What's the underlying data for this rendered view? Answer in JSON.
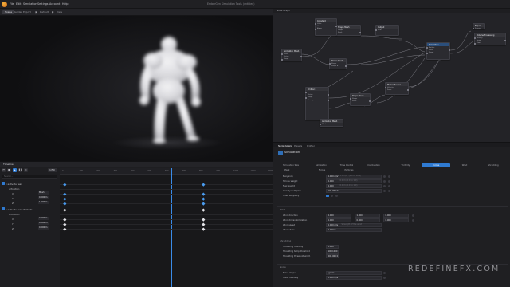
{
  "menubar": {
    "items": [
      "File",
      "Edit",
      "Simulation",
      "Settings",
      "Account",
      "Help"
    ],
    "title": "EmberGen Simulation Tools (untitled)"
  },
  "toolbar": {
    "tabs": [
      "Scene",
      "Render",
      "Export"
    ],
    "default_label": "Default",
    "view_label": "View"
  },
  "colors": {
    "accent": "#2f7ad1",
    "logo": "#e8922a"
  },
  "icons": {
    "play": "play-icon",
    "pause": "pause-icon",
    "stop": "stop-icon",
    "skip": "skip-icon",
    "loop": "loop-icon"
  },
  "timeline": {
    "title": "Timeline",
    "frame": "1/50",
    "search_placeholder": "Search...",
    "ruler": [
      "0",
      "100",
      "200",
      "300",
      "400",
      "500",
      "600",
      "700",
      "800",
      "900",
      "1000",
      "1100",
      "1200"
    ],
    "tracks": [
      {
        "label": "ⅴ activate tear",
        "value": "",
        "indent": 0,
        "checked": true
      },
      {
        "label": "ⅴ Position",
        "value": "",
        "indent": 1,
        "checked": false
      },
      {
        "label": "X",
        "value": "Mesh",
        "indent": 2,
        "checked": false
      },
      {
        "label": "Y",
        "value": "0.000 m",
        "indent": 2,
        "checked": false
      },
      {
        "label": "Z",
        "value": "1.000 m",
        "indent": 2,
        "checked": false
      },
      {
        "label": "ⅴ activate tear attribute",
        "value": "",
        "indent": 0,
        "checked": true
      },
      {
        "label": "ⅴ Position",
        "value": "",
        "indent": 1,
        "checked": false
      },
      {
        "label": "X",
        "value": "0.000 m",
        "indent": 2,
        "checked": false
      },
      {
        "label": "Y",
        "value": "0.000 m",
        "indent": 2,
        "checked": false
      },
      {
        "label": "Z",
        "value": "0.000 m",
        "indent": 2,
        "checked": false
      }
    ]
  },
  "nodegraph": {
    "title": "Node Graph",
    "nodes": [
      {
        "title": "Animation Mesh",
        "pins": [
          "Mesh",
          "Vertex",
          "Shape"
        ]
      },
      {
        "title": "Shape Mesh",
        "pins": [
          "Shape",
          "Mesh"
        ]
      },
      {
        "title": "Shape Mesh",
        "pins": [
          "Shape",
          "Shape B"
        ]
      },
      {
        "title": "Constant",
        "pins": [
          "Value",
          "Vector",
          "Alpha"
        ]
      },
      {
        "title": "Output",
        "pins": [
          "Final"
        ]
      },
      {
        "title": "Simulation",
        "pins": [
          "Emitter",
          "Force",
          "Shape"
        ]
      },
      {
        "title": "Export",
        "pins": [
          "Frames"
        ]
      },
      {
        "title": "Volume Processing",
        "pins": [
          "Density",
          "Temp",
          "Flame"
        ]
      },
      {
        "title": "Emitter 2",
        "pins": [
          "Source",
          "Vertex",
          "Shape",
          "Density"
        ]
      },
      {
        "title": "Shape Mesh",
        "pins": [
          "Shape",
          "Mesh"
        ]
      },
      {
        "title": "Motion Source",
        "pins": [
          "Velocity",
          "Force"
        ]
      },
      {
        "title": "Animation Mesh",
        "pins": [
          "Mesh"
        ]
      }
    ]
  },
  "inspector": {
    "tabs": [
      "Node details",
      "Presets",
      "Profiler"
    ],
    "title": "Simulation",
    "categories_row1": [
      "Simulation Size",
      "Simulation",
      "Time Control",
      "Combustion",
      "Vorticity",
      "Forces",
      "Wind",
      "Shredding"
    ],
    "categories_row2": [
      "Mask",
      "Forces",
      "Particles"
    ],
    "active_category": "Forces",
    "props_main": [
      {
        "label": "Buoyancy",
        "value": "0.000 m/s²",
        "hint": "3.0 m/s² (0.0 to 10.0)",
        "mode": "text"
      },
      {
        "label": "Smoke weight",
        "value": "0.000",
        "hint": "0.1 m (0.0 to 1.0)",
        "mode": "text"
      },
      {
        "label": "Fuel weight",
        "value": "0.000",
        "hint": "0.1 m (0.0 to 1.0)",
        "mode": "text"
      },
      {
        "label": "Gravity multiplier",
        "value": "100.000 %",
        "hint": "",
        "mode": "text"
      },
      {
        "label": "Scale buoyancy",
        "value": "",
        "hint": "",
        "mode": "check"
      }
    ],
    "section_wind": "Wind",
    "props_wind": [
      {
        "label": "Wind direction",
        "v1": "0.000",
        "v2": "1.000",
        "v3": "0.000"
      },
      {
        "label": "Wind dir randomization",
        "v1": "0.000",
        "v2": "0.000",
        "v3": "0.000"
      }
    ],
    "props_wind2": [
      {
        "label": "Wind speed",
        "value": "0.000 m/s",
        "hint": "Strength of the wind"
      },
      {
        "label": "Wind shear",
        "value": "0.000 %",
        "hint": ""
      }
    ],
    "section_shredding": "Shredding",
    "props_shred": [
      {
        "label": "Shredding intensity",
        "value": "0.000"
      },
      {
        "label": "Shredding temp threshold",
        "value": "1000.000 K"
      },
      {
        "label": "Shredding threshold width",
        "value": "200.000 K"
      }
    ],
    "section_noise": "Noise",
    "props_noise": [
      {
        "label": "Noise shape",
        "value": "Ignore"
      },
      {
        "label": "Noise intensity",
        "value": "0.000 m/s²"
      }
    ]
  },
  "watermark": "REDEFINEFX.COM"
}
